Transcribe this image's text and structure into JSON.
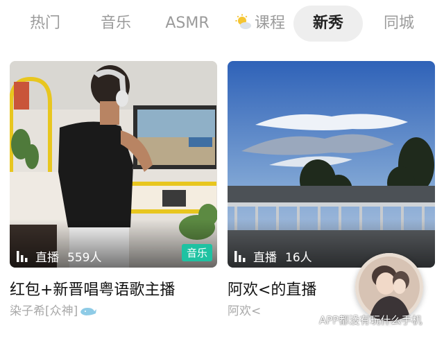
{
  "tabs": [
    {
      "label": "热门"
    },
    {
      "label": "音乐"
    },
    {
      "label": "ASMR"
    },
    {
      "label": "课程"
    },
    {
      "label": "新秀",
      "active": true
    },
    {
      "label": "同城"
    }
  ],
  "cards": [
    {
      "status": "直播",
      "viewers": "559人",
      "tag": "音乐",
      "title": "红包+新晋唱粤语歌主播",
      "host": "染子希[众神]"
    },
    {
      "status": "直播",
      "viewers": "16人",
      "title": "阿欢<的直播",
      "host": "阿欢<"
    }
  ],
  "watermark": {
    "text": "APP都没有玩什么手机",
    "icon": "wechat-icon"
  },
  "colors": {
    "active_tab_bg": "#eeeeee",
    "tag_bg": "#1fc2a2",
    "inactive_tab_text": "#9b9b9b"
  }
}
